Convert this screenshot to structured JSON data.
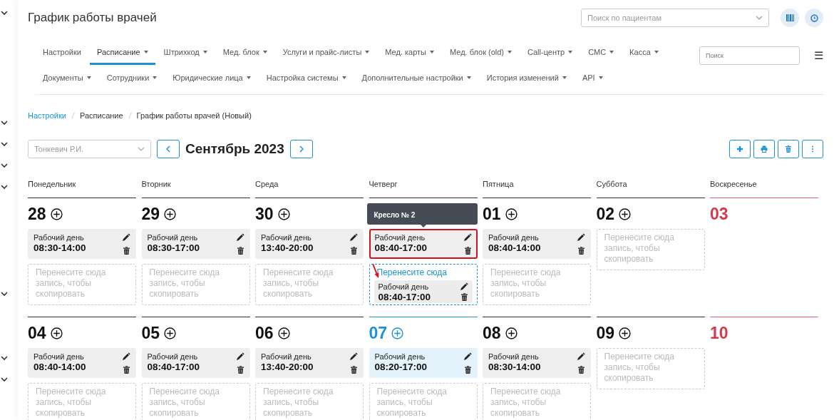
{
  "header": {
    "title": "График работы врачей",
    "patient_search": {
      "placeholder": "Поиск по пациентам"
    }
  },
  "nav": {
    "rows": [
      {
        "items": [
          {
            "label": "Настройки",
            "dropdown": false,
            "selected": false
          },
          {
            "label": "Расписание",
            "dropdown": true,
            "selected": true
          },
          {
            "label": "Штрихкод",
            "dropdown": true,
            "selected": false
          },
          {
            "label": "Мед. блок",
            "dropdown": true,
            "selected": false
          },
          {
            "label": "Услуги и прайс-листы",
            "dropdown": true,
            "selected": false
          },
          {
            "label": "Мед. карты",
            "dropdown": true,
            "selected": false
          },
          {
            "label": "Мед. блок (old)",
            "dropdown": true,
            "selected": false
          },
          {
            "label": "Call-центр",
            "dropdown": true,
            "selected": false
          },
          {
            "label": "СМС",
            "dropdown": true,
            "selected": false
          },
          {
            "label": "Касса",
            "dropdown": true,
            "selected": false
          }
        ]
      },
      {
        "items": [
          {
            "label": "Документы",
            "dropdown": true,
            "selected": false
          },
          {
            "label": "Сотрудники",
            "dropdown": true,
            "selected": false
          },
          {
            "label": "Юридические лица",
            "dropdown": true,
            "selected": false
          },
          {
            "label": "Настройка системы",
            "dropdown": true,
            "selected": false
          },
          {
            "label": "Дополнительные настройки",
            "dropdown": true,
            "selected": false
          },
          {
            "label": "История изменений",
            "dropdown": true,
            "selected": false
          },
          {
            "label": "API",
            "dropdown": true,
            "selected": false
          }
        ]
      }
    ],
    "search": {
      "placeholder": "Поиск"
    },
    "menu_glyph": "☰"
  },
  "breadcrumb": [
    {
      "label": "Настройки",
      "link": true
    },
    {
      "label": "Расписание",
      "link": false
    },
    {
      "label": "График работы врачей (Новый)",
      "link": false
    }
  ],
  "toolbar": {
    "doctor": {
      "value": "Тонкевич Р.И."
    },
    "month": "Сентябрь 2023"
  },
  "weekdays": [
    "Понедельник",
    "Вторник",
    "Среда",
    "Четверг",
    "Пятница",
    "Суббота",
    "Воскресенье"
  ],
  "weeks": [
    {
      "days": [
        {
          "date": "28",
          "kind": "weekday",
          "today": false,
          "shifts": [
            {
              "label": "Рабочий день",
              "time": "08:30-14:00",
              "selected": false
            }
          ],
          "dropzone": {
            "text": "Перенесите сюда запись, чтобы скопировать",
            "active": false
          }
        },
        {
          "date": "29",
          "kind": "weekday",
          "today": false,
          "shifts": [
            {
              "label": "Рабочий день",
              "time": "08:30-17:00",
              "selected": false
            }
          ],
          "dropzone": {
            "text": "Перенесите сюда запись, чтобы скопировать",
            "active": false
          }
        },
        {
          "date": "30",
          "kind": "weekday",
          "today": false,
          "shifts": [
            {
              "label": "Рабочий день",
              "time": "13:40-20:00",
              "selected": false
            }
          ],
          "dropzone": {
            "text": "Перенесите сюда запись, чтобы скопировать",
            "active": false
          }
        },
        {
          "kind": "weekday",
          "today": false,
          "tooltip": "Кресло № 2",
          "shifts": [
            {
              "label": "Рабочий день",
              "time": "08:40-17:00",
              "selected": true
            }
          ],
          "dropzone": {
            "text": "Перенесите сюда",
            "active": true,
            "drag_preview": {
              "label": "Рабочий день",
              "time": "08:40-17:00"
            }
          }
        },
        {
          "date": "01",
          "kind": "weekday",
          "today": false,
          "shifts": [
            {
              "label": "Рабочий день",
              "time": "08:40-14:00",
              "selected": false
            }
          ],
          "dropzone": {
            "text": "Перенесите сюда запись, чтобы скопировать",
            "active": false
          }
        },
        {
          "date": "02",
          "kind": "weekday",
          "today": false,
          "dropzone": {
            "text": "Перенесите сюда запись, чтобы скопировать",
            "active": false
          }
        },
        {
          "date": "03",
          "kind": "holiday",
          "today": false
        }
      ]
    },
    {
      "days": [
        {
          "date": "04",
          "kind": "weekday",
          "today": false,
          "shifts": [
            {
              "label": "Рабочий день",
              "time": "08:40-14:00",
              "selected": false
            }
          ],
          "dropzone": {
            "text": "Перенесите сюда запись, чтобы скопировать",
            "active": false
          }
        },
        {
          "date": "05",
          "kind": "weekday",
          "today": false,
          "shifts": [
            {
              "label": "Рабочий день",
              "time": "08:40-17:00",
              "selected": false
            }
          ],
          "dropzone": {
            "text": "Перенесите сюда запись, чтобы скопировать",
            "active": false
          }
        },
        {
          "date": "06",
          "kind": "weekday",
          "today": false,
          "shifts": [
            {
              "label": "Рабочий день",
              "time": "13:40-20:00",
              "selected": false
            }
          ],
          "dropzone": {
            "text": "Перенесите сюда запись, чтобы скопировать",
            "active": false
          }
        },
        {
          "date": "07",
          "kind": "weekday",
          "today": true,
          "shifts": [
            {
              "label": "Рабочий день",
              "time": "08:20-17:00",
              "selected": false
            }
          ],
          "dropzone": {
            "text": "Перенесите сюда запись, чтобы скопировать",
            "active": false
          }
        },
        {
          "date": "08",
          "kind": "weekday",
          "today": false,
          "shifts": [
            {
              "label": "Рабочий день",
              "time": "08:30-14:00",
              "selected": false
            }
          ],
          "dropzone": {
            "text": "Перенесите сюда запись, чтобы скопировать",
            "active": false
          }
        },
        {
          "date": "09",
          "kind": "weekday",
          "today": false,
          "dropzone": {
            "text": "Перенесите сюда запись, чтобы скопировать",
            "active": false
          }
        },
        {
          "date": "10",
          "kind": "holiday",
          "today": false
        }
      ]
    }
  ]
}
